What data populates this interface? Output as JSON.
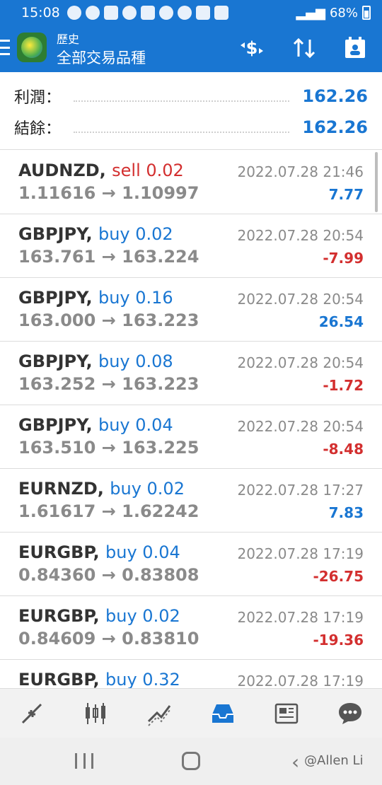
{
  "status_bar": {
    "time": "15:08",
    "battery": "68%"
  },
  "app_bar": {
    "subtitle": "歷史",
    "title": "全部交易品種"
  },
  "summary": {
    "profit_label": "利潤：",
    "profit_value": "162.26",
    "balance_label": "結餘：",
    "balance_value": "162.26"
  },
  "trades": [
    {
      "symbol": "AUDNZD,",
      "side": "sell 0.02",
      "prices": "1.11616 → 1.10997",
      "date": "2022.07.28 21:46",
      "profit": "7.77"
    },
    {
      "symbol": "GBPJPY,",
      "side": "buy 0.02",
      "prices": "163.761 → 163.224",
      "date": "2022.07.28 20:54",
      "profit": "-7.99"
    },
    {
      "symbol": "GBPJPY,",
      "side": "buy 0.16",
      "prices": "163.000 → 163.223",
      "date": "2022.07.28 20:54",
      "profit": "26.54"
    },
    {
      "symbol": "GBPJPY,",
      "side": "buy 0.08",
      "prices": "163.252 → 163.223",
      "date": "2022.07.28 20:54",
      "profit": "-1.72"
    },
    {
      "symbol": "GBPJPY,",
      "side": "buy 0.04",
      "prices": "163.510 → 163.225",
      "date": "2022.07.28 20:54",
      "profit": "-8.48"
    },
    {
      "symbol": "EURNZD,",
      "side": "buy 0.02",
      "prices": "1.61617 → 1.62242",
      "date": "2022.07.28 17:27",
      "profit": "7.83"
    },
    {
      "symbol": "EURGBP,",
      "side": "buy 0.04",
      "prices": "0.84360 → 0.83808",
      "date": "2022.07.28 17:19",
      "profit": "-26.75"
    },
    {
      "symbol": "EURGBP,",
      "side": "buy 0.02",
      "prices": "0.84609 → 0.83810",
      "date": "2022.07.28 17:19",
      "profit": "-19.36"
    },
    {
      "symbol": "EURGBP,",
      "side": "buy 0.32",
      "prices": "",
      "date": "2022.07.28 17:19",
      "profit": ""
    }
  ],
  "bottom_nav": [
    "quotes-icon",
    "chart-icon",
    "trade-icon",
    "history-icon",
    "news-icon",
    "chat-icon"
  ],
  "watermark": "@Allen Li",
  "colors": {
    "accent": "#1976d2",
    "negative": "#d32f2f",
    "muted": "#8a8a8a"
  }
}
